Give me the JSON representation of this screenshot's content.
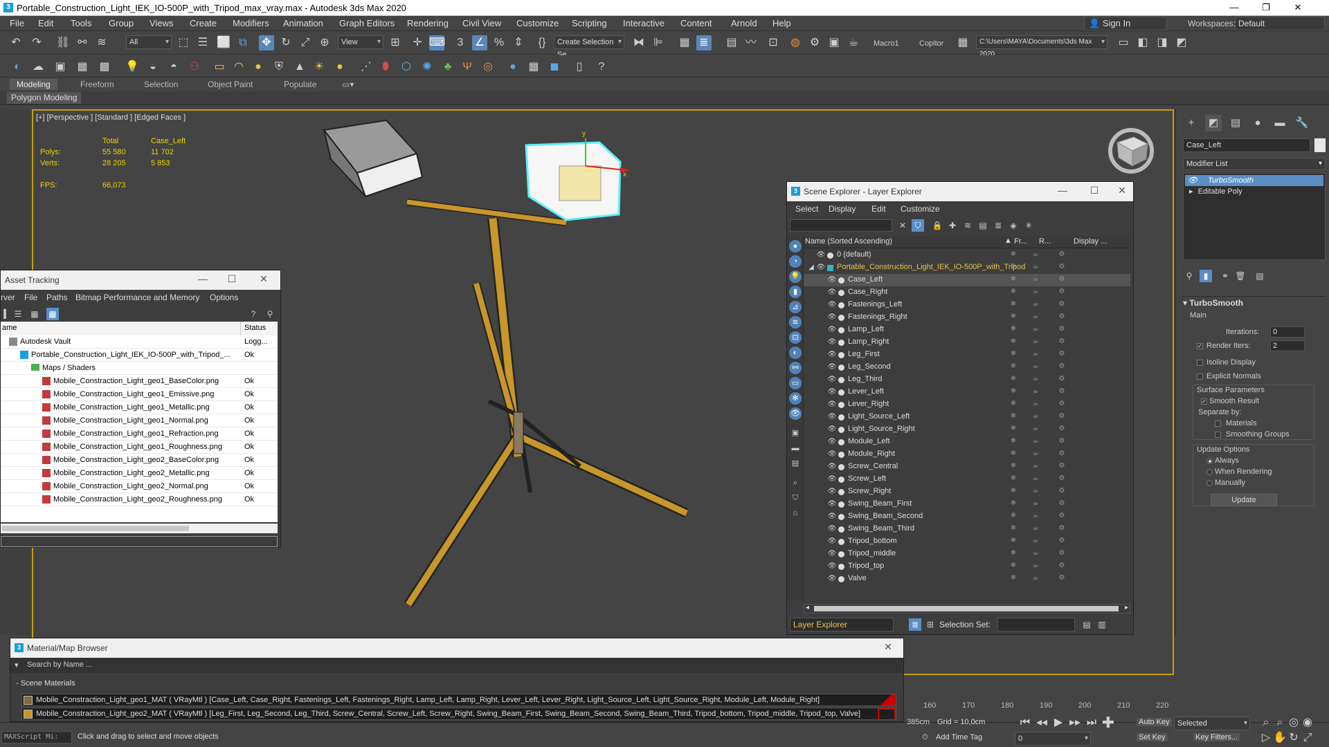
{
  "titlebar": {
    "title": "Portable_Construction_Light_IEK_IO-500P_with_Tripod_max_vray.max - Autodesk 3ds Max 2020",
    "app_icon": "3"
  },
  "menu": {
    "items": [
      "File",
      "Edit",
      "Tools",
      "Group",
      "Views",
      "Create",
      "Modifiers",
      "Animation",
      "Graph Editors",
      "Rendering",
      "Civil View",
      "Customize",
      "Scripting",
      "Interactive",
      "Content",
      "Arnold",
      "Help"
    ],
    "sign_in": "Sign In",
    "workspaces_label": "Workspaces:",
    "workspace_value": "Default"
  },
  "toolbar": {
    "filter_all": "All",
    "view_dropdown": "View",
    "create_selection_set": "Create Selection Se",
    "macro1": "Macro1",
    "copitor": "Copitor",
    "project_path": "C:\\Users\\MAYA\\Documents\\3ds Max 2020"
  },
  "ribbon": {
    "tabs": [
      "Modeling",
      "Freeform",
      "Selection",
      "Object Paint",
      "Populate"
    ],
    "active_tab": "Modeling",
    "sub_label": "Polygon Modeling"
  },
  "viewport": {
    "label": "[+] [Perspective ] [Standard ] [Edged Faces ]",
    "stats_header_total": "Total",
    "stats_header_obj": "Case_Left",
    "polys_label": "Polys:",
    "polys_total": "55 580",
    "polys_obj": "11 702",
    "verts_label": "Verts:",
    "verts_total": "28 205",
    "verts_obj": "5 853",
    "fps_label": "FPS:",
    "fps_value": "66,073",
    "axis_x": "x",
    "axis_y": "y"
  },
  "scene_explorer": {
    "title": "Scene Explorer - Layer Explorer",
    "menu": [
      "Select",
      "Display",
      "Edit",
      "Customize"
    ],
    "col_name": "Name (Sorted Ascending)",
    "col_fr": "Fr...",
    "col_r": "R...",
    "col_display": "Display ...",
    "default_layer": "0 (default)",
    "root_layer": "Portable_Construction_Light_IEK_IO-500P_with_Tripod",
    "objects": [
      "Case_Left",
      "Case_Right",
      "Fastenings_Left",
      "Fastenings_Right",
      "Lamp_Left",
      "Lamp_Right",
      "Leg_First",
      "Leg_Second",
      "Leg_Third",
      "Lever_Left",
      "Lever_Right",
      "Light_Source_Left",
      "Light_Source_Right",
      "Module_Left",
      "Module_Right",
      "Screw_Central",
      "Screw_Left",
      "Screw_Right",
      "Swing_Beam_First",
      "Swing_Beam_Second",
      "Swing_Beam_Third",
      "Tripod_bottom",
      "Tripod_middle",
      "Tripod_top",
      "Valve"
    ],
    "selected_object": "Case_Left",
    "explorer_type": "Layer Explorer",
    "selection_set_label": "Selection Set:"
  },
  "asset_tracking": {
    "title": "Asset Tracking",
    "menu": [
      "rver",
      "File",
      "Paths",
      "Bitmap Performance and Memory",
      "Options"
    ],
    "col_name": "ame",
    "col_status": "Status",
    "rows": [
      {
        "name": "Autodesk Vault",
        "status": "Logg...",
        "indent": 0,
        "icon": "vault"
      },
      {
        "name": "Portable_Construction_Light_IEK_IO-500P_with_Tripod_...",
        "status": "Ok",
        "indent": 1,
        "icon": "max"
      },
      {
        "name": "Maps / Shaders",
        "status": "",
        "indent": 2,
        "icon": "folder"
      },
      {
        "name": "Mobile_Constraction_Light_geo1_BaseColor.png",
        "status": "Ok",
        "indent": 3,
        "icon": "file"
      },
      {
        "name": "Mobile_Constraction_Light_geo1_Emissive.png",
        "status": "Ok",
        "indent": 3,
        "icon": "file"
      },
      {
        "name": "Mobile_Constraction_Light_geo1_Metallic.png",
        "status": "Ok",
        "indent": 3,
        "icon": "file"
      },
      {
        "name": "Mobile_Constraction_Light_geo1_Normal.png",
        "status": "Ok",
        "indent": 3,
        "icon": "file"
      },
      {
        "name": "Mobile_Constraction_Light_geo1_Refraction.png",
        "status": "Ok",
        "indent": 3,
        "icon": "file"
      },
      {
        "name": "Mobile_Constraction_Light_geo1_Roughness.png",
        "status": "Ok",
        "indent": 3,
        "icon": "file"
      },
      {
        "name": "Mobile_Constraction_Light_geo2_BaseColor.png",
        "status": "Ok",
        "indent": 3,
        "icon": "file"
      },
      {
        "name": "Mobile_Constraction_Light_geo2_Metallic.png",
        "status": "Ok",
        "indent": 3,
        "icon": "file"
      },
      {
        "name": "Mobile_Constraction_Light_geo2_Normal.png",
        "status": "Ok",
        "indent": 3,
        "icon": "file"
      },
      {
        "name": "Mobile_Constraction_Light_geo2_Roughness.png",
        "status": "Ok",
        "indent": 3,
        "icon": "file"
      }
    ]
  },
  "material_browser": {
    "title": "Material/Map Browser",
    "search_placeholder": "Search by Name ...",
    "scene_materials": "- Scene Materials",
    "materials": [
      "Mobile_Constraction_Light_geo1_MAT ( VRayMtl ) [Case_Left, Case_Right, Fastenings_Left, Fastenings_Right, Lamp_Left, Lamp_Right, Lever_Left, Lever_Right, Light_Source_Left, Light_Source_Right, Module_Left, Module_Right]",
      "Mobile_Constraction_Light_geo2_MAT ( VRayMtl ) [Leg_First, Leg_Second, Leg_Third, Screw_Central, Screw_Left, Screw_Right, Swing_Beam_First, Swing_Beam_Second, Swing_Beam_Third, Tripod_bottom, Tripod_middle, Tripod_top, Valve]"
    ]
  },
  "command_panel": {
    "object_name": "Case_Left",
    "modifier_list": "Modifier List",
    "stack": [
      "TurboSmooth",
      "Editable Poly"
    ],
    "rollout_title": "TurboSmooth",
    "main_label": "Main",
    "iterations_label": "Iterations:",
    "iterations_value": "0",
    "render_iters_label": "Render Iters:",
    "render_iters_value": "2",
    "isoline_display": "Isoline Display",
    "explicit_normals": "Explicit Normals",
    "surface_parameters": "Surface Parameters",
    "smooth_result": "Smooth Result",
    "separate_by": "Separate by:",
    "materials": "Materials",
    "smoothing_groups": "Smoothing Groups",
    "update_options": "Update Options",
    "always": "Always",
    "when_rendering": "When Rendering",
    "manually": "Manually",
    "update_button": "Update"
  },
  "timeline": {
    "ticks": [
      "160",
      "170",
      "180",
      "190",
      "200",
      "210",
      "220"
    ],
    "coord_readout": "385cm",
    "grid": "Grid = 10,0cm",
    "add_time_tag": "Add Time Tag",
    "auto_key": "Auto Key",
    "set_key": "Set Key",
    "selected": "Selected",
    "key_filters": "Key Filters...",
    "frame": "0"
  },
  "status": {
    "maxscript": "MAXScript Mi:",
    "message": "Click and drag to select and move objects"
  },
  "colors": {
    "viewport_border": "#c9a000",
    "selection_blue": "#5a8fc6",
    "wood": "#c8962a"
  }
}
